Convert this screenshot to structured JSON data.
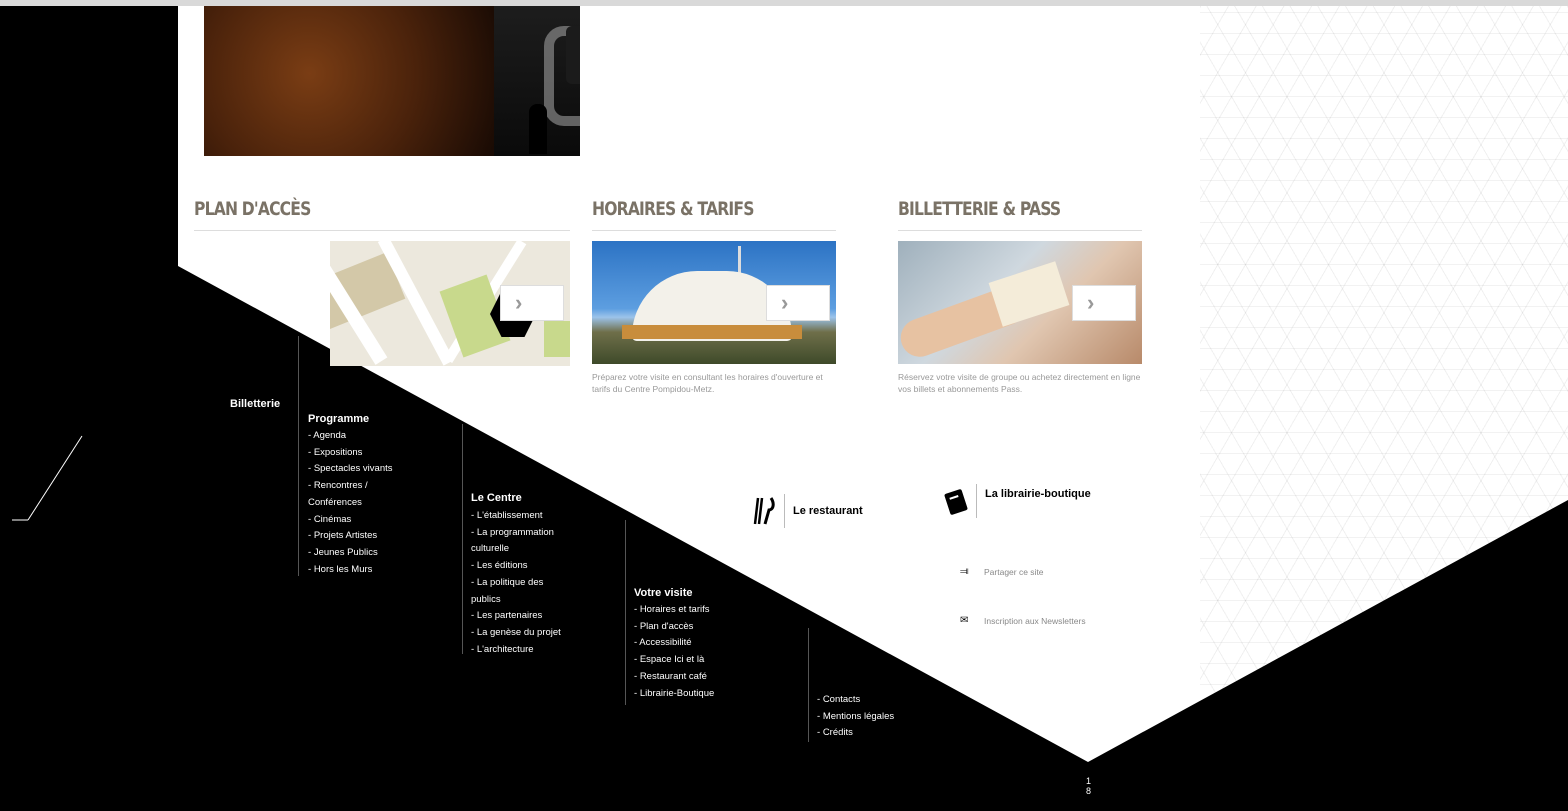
{
  "sections": {
    "plan_acces": {
      "title": "PLAN D'ACCÈS"
    },
    "horaires": {
      "title": "HORAIRES & TARIFS",
      "caption": "Préparez votre visite en consultant les horaires d'ouverture et tarifs du Centre Pompidou-Metz."
    },
    "billetterie": {
      "title": "BILLETTERIE & PASS",
      "caption": "Réservez votre visite de groupe ou achetez directement en ligne vos billets et abonnements Pass."
    },
    "arrow_glyph": "›"
  },
  "services": {
    "restaurant": "Le restaurant",
    "librairie": "La librairie-boutique"
  },
  "share": {
    "share_site": "Partager ce site",
    "newsletter": "Inscription aux Newsletters"
  },
  "footer": {
    "billetterie": "Billetterie",
    "programme": {
      "title": "Programme",
      "items": [
        "Agenda",
        "Expositions",
        "Spectacles vivants",
        "Rencontres /\nConférences",
        "Cinémas",
        "Projets Artistes",
        "Jeunes Publics",
        "Hors les Murs"
      ]
    },
    "centre": {
      "title": "Le Centre",
      "items": [
        "L'établissement",
        "La programmation\nculturelle",
        "Les éditions",
        "La politique des\npublics",
        "Les partenaires",
        "La genèse du projet",
        "L'architecture"
      ]
    },
    "visite": {
      "title": "Votre visite",
      "items": [
        "Horaires et tarifs",
        "Plan d'accès",
        "Accessibilité",
        "Espace Ici et là",
        "Restaurant café",
        "Librairie-Boutique"
      ]
    },
    "misc": {
      "items": [
        "Contacts",
        "Mentions légales",
        "Crédits"
      ]
    }
  },
  "page_marker": "1\n8",
  "colors": {
    "section_title": "#7a7266",
    "caption": "#999999",
    "accent_black": "#000000"
  },
  "icons": [
    "play-icon",
    "chevron-right-icon",
    "fork-knife-icon",
    "book-icon",
    "share-icon",
    "envelope-icon"
  ]
}
